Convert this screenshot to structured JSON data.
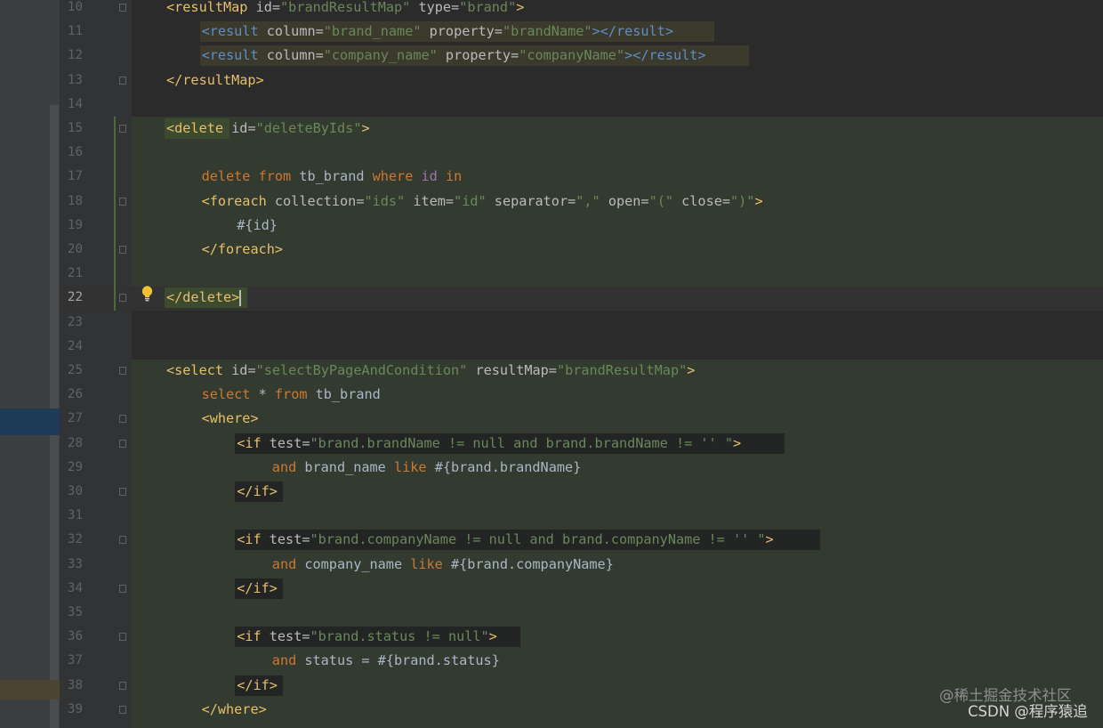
{
  "editor": {
    "line_numbers": [
      "10",
      "11",
      "12",
      "13",
      "14",
      "15",
      "16",
      "17",
      "18",
      "19",
      "20",
      "21",
      "22",
      "23",
      "24",
      "25",
      "26",
      "27",
      "28",
      "29",
      "30",
      "31",
      "32",
      "33",
      "34",
      "35",
      "36",
      "37",
      "38",
      "39"
    ],
    "current_line": "22",
    "code": [
      {
        "tokens": [
          [
            "t",
            "<resultMap"
          ],
          [
            "a",
            " id="
          ],
          [
            "v",
            "\"brandResultMap\""
          ],
          [
            "a",
            " type="
          ],
          [
            "v",
            "\"brand\""
          ],
          [
            "t",
            ">"
          ]
        ]
      },
      {
        "tokens": [
          [
            "res-t",
            "<result"
          ],
          [
            "res-a",
            " column="
          ],
          [
            "res-v",
            "\"brand_name\""
          ],
          [
            "res-a",
            " property="
          ],
          [
            "res-v",
            "\"brandName\""
          ],
          [
            "res-t",
            "></result>"
          ]
        ]
      },
      {
        "tokens": [
          [
            "res-t",
            "<result"
          ],
          [
            "res-a",
            " column="
          ],
          [
            "res-v",
            "\"company_name\""
          ],
          [
            "res-a",
            " property="
          ],
          [
            "res-v",
            "\"companyName\""
          ],
          [
            "res-t",
            "></result>"
          ]
        ]
      },
      {
        "tokens": [
          [
            "t",
            "</resultMap>"
          ]
        ]
      },
      {
        "tokens": []
      },
      {
        "tokens": [
          [
            "tb",
            "<delete"
          ],
          [
            "a",
            " id="
          ],
          [
            "v",
            "\"deleteByIds\""
          ],
          [
            "t",
            ">"
          ]
        ]
      },
      {
        "tokens": []
      },
      {
        "tokens": [
          [
            "k",
            "delete from "
          ],
          [
            "p",
            "tb_brand "
          ],
          [
            "k",
            "where "
          ],
          [
            "fld",
            "id "
          ],
          [
            "k",
            "in"
          ]
        ]
      },
      {
        "tokens": [
          [
            "t",
            "<foreach"
          ],
          [
            "a",
            " collection="
          ],
          [
            "v",
            "\"ids\""
          ],
          [
            "a",
            " item="
          ],
          [
            "v",
            "\"id\""
          ],
          [
            "a",
            " separator="
          ],
          [
            "v",
            "\",\""
          ],
          [
            "a",
            " open="
          ],
          [
            "v",
            "\"(\""
          ],
          [
            "a",
            " close="
          ],
          [
            "v",
            "\")\""
          ],
          [
            "t",
            ">"
          ]
        ]
      },
      {
        "tokens": [
          [
            "p",
            "#{id}"
          ]
        ]
      },
      {
        "tokens": [
          [
            "t",
            "</foreach>"
          ]
        ]
      },
      {
        "tokens": []
      },
      {
        "tokens": [
          [
            "tb",
            "</delete>"
          ]
        ]
      },
      {
        "tokens": []
      },
      {
        "tokens": []
      },
      {
        "tokens": [
          [
            "t",
            "<select"
          ],
          [
            "a",
            " id="
          ],
          [
            "v",
            "\"selectByPageAndCondition\""
          ],
          [
            "a",
            " resultMap="
          ],
          [
            "v",
            "\"brandResultMap\""
          ],
          [
            "t",
            ">"
          ]
        ]
      },
      {
        "tokens": [
          [
            "k",
            "select "
          ],
          [
            "p",
            "* "
          ],
          [
            "k",
            "from "
          ],
          [
            "p",
            "tb_brand"
          ]
        ]
      },
      {
        "tokens": [
          [
            "t",
            "<where>"
          ]
        ]
      },
      {
        "tokens": [
          [
            "t",
            "<if"
          ],
          [
            "a",
            " test="
          ],
          [
            "v",
            "\"brand.brandName != null and brand.brandName != '' \""
          ],
          [
            "t",
            ">"
          ]
        ]
      },
      {
        "tokens": [
          [
            "k",
            "and "
          ],
          [
            "p",
            "brand_name "
          ],
          [
            "k",
            "like "
          ],
          [
            "p",
            "#{brand.brandName}"
          ]
        ]
      },
      {
        "tokens": [
          [
            "t",
            "</if>"
          ]
        ]
      },
      {
        "tokens": []
      },
      {
        "tokens": [
          [
            "t",
            "<if"
          ],
          [
            "a",
            " test="
          ],
          [
            "v",
            "\"brand.companyName != null and brand.companyName != '' \""
          ],
          [
            "t",
            ">"
          ]
        ]
      },
      {
        "tokens": [
          [
            "k",
            "and "
          ],
          [
            "p",
            "company_name "
          ],
          [
            "k",
            "like "
          ],
          [
            "p",
            "#{brand.companyName}"
          ]
        ]
      },
      {
        "tokens": [
          [
            "t",
            "</if>"
          ]
        ]
      },
      {
        "tokens": []
      },
      {
        "tokens": [
          [
            "t",
            "<if"
          ],
          [
            "a",
            " test="
          ],
          [
            "v",
            "\"brand.status != null\""
          ],
          [
            "t",
            ">"
          ]
        ]
      },
      {
        "tokens": [
          [
            "k",
            "and "
          ],
          [
            "p",
            "status "
          ],
          [
            "p",
            "= #{brand.status}"
          ]
        ]
      },
      {
        "tokens": [
          [
            "t",
            "</if>"
          ]
        ]
      },
      {
        "tokens": [
          [
            "t",
            "</where>"
          ]
        ]
      }
    ]
  },
  "colors": {
    "editor_bg": "#2b2b2b",
    "gutter_bg": "#313335",
    "tag": "#e8bf6a",
    "attr": "#bababa",
    "string": "#6a8759",
    "keyword": "#cc7832",
    "field": "#9876aa",
    "scope_highlight": "#333b31"
  },
  "watermark": {
    "line1": "@稀土掘金技术社区",
    "line2": "CSDN @程序猿追"
  }
}
